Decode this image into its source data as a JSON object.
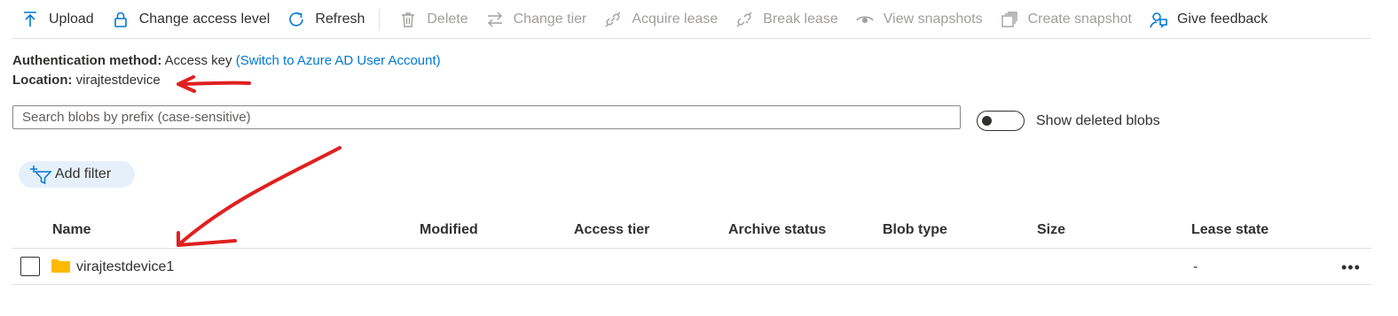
{
  "toolbar": {
    "upload": "Upload",
    "change_access_level": "Change access level",
    "refresh": "Refresh",
    "delete": "Delete",
    "change_tier": "Change tier",
    "acquire_lease": "Acquire lease",
    "break_lease": "Break lease",
    "view_snapshots": "View snapshots",
    "create_snapshot": "Create snapshot",
    "give_feedback": "Give feedback"
  },
  "info": {
    "auth_label": "Authentication method:",
    "auth_value": "Access key",
    "auth_link": "(Switch to Azure AD User Account)",
    "location_label": "Location:",
    "location_value": "virajtestdevice"
  },
  "search": {
    "placeholder": "Search blobs by prefix (case-sensitive)",
    "value": ""
  },
  "toggle": {
    "label": "Show deleted blobs",
    "on": false
  },
  "filter": {
    "label": "Add filter"
  },
  "table": {
    "columns": [
      "Name",
      "Modified",
      "Access tier",
      "Archive status",
      "Blob type",
      "Size",
      "Lease state"
    ],
    "rows": [
      {
        "name": "virajtestdevice1",
        "modified": "",
        "access_tier": "",
        "archive_status": "",
        "blob_type": "",
        "size": "",
        "lease_state": "-",
        "more": "•••"
      }
    ]
  },
  "colors": {
    "accent": "#0078d4",
    "annotation": "#e02020",
    "folder": "#ffb900",
    "pill_bg": "#e6f0fa"
  }
}
